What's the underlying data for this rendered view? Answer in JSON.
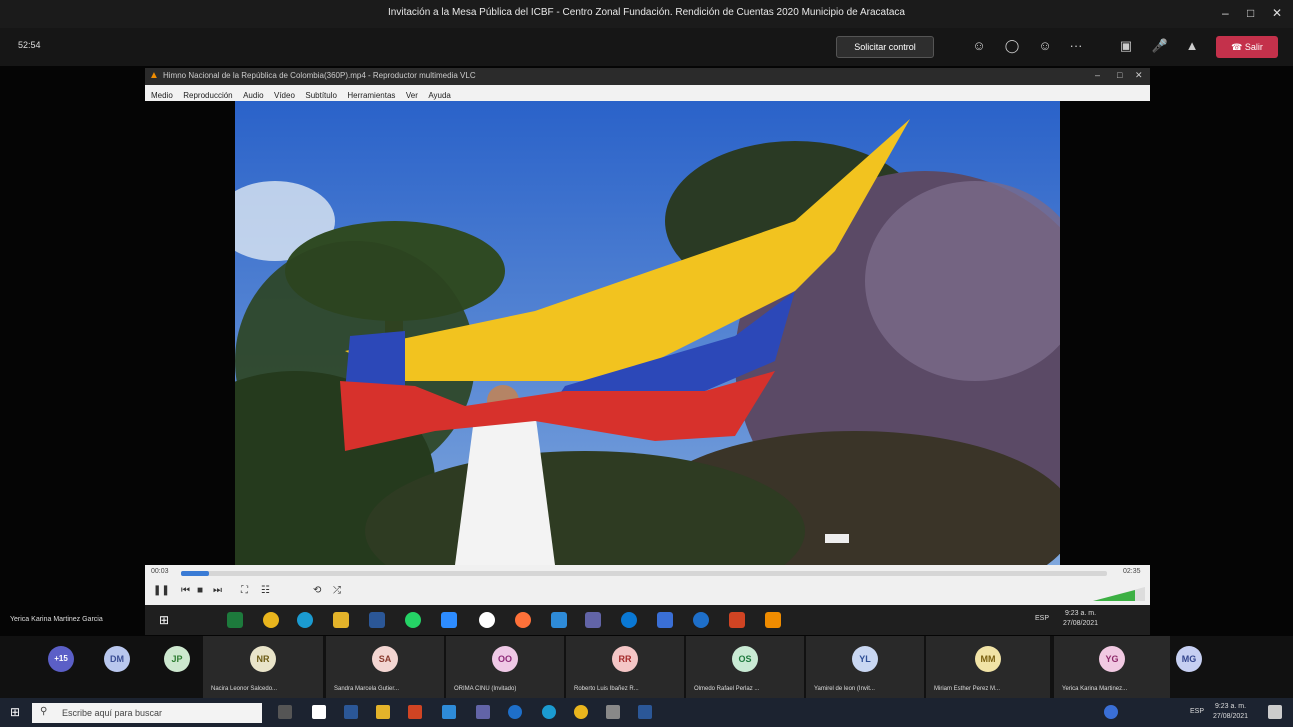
{
  "window": {
    "title": "Invitación a la Mesa Pública del ICBF - Centro Zonal Fundación. Rendición de Cuentas 2020 Municipio de Aracataca",
    "controls": [
      "–",
      "□",
      "✕"
    ]
  },
  "toolbar": {
    "timer": "52:54",
    "request_control_label": "Solicitar control",
    "more_label": "···",
    "leave_label": "Salir"
  },
  "vlc": {
    "title": "Himno Nacional de la República de Colombia(360P).mp4 - Reproductor multimedia VLC",
    "menu": [
      "Medio",
      "Reproducción",
      "Audio",
      "Vídeo",
      "Subtítulo",
      "Herramientas",
      "Ver",
      "Ayuda"
    ],
    "time_elapsed": "00:03",
    "time_total": "02:35",
    "progress": 0.03,
    "controls": [
      "❚❚",
      "⏮",
      "■",
      "⏭",
      "⛶",
      "☷",
      "⟲",
      "⤮"
    ]
  },
  "presenter": {
    "name": "Yerica Karina Martinez Garcia",
    "clock_time": "9:23 a. m.",
    "clock_date": "27/08/2021",
    "lang": "ESP"
  },
  "participants": {
    "overflow": "+15",
    "avatars": [
      {
        "initials": "DM",
        "name": "",
        "bg": "#b9c7ee",
        "fg": "#3c4f95"
      },
      {
        "initials": "JP",
        "name": "",
        "bg": "#cde8cf",
        "fg": "#2e7d32"
      },
      {
        "initials": "NR",
        "name": "Nacira Leonor Salcedo...",
        "bg": "#e9e4c9",
        "fg": "#6b5a12"
      },
      {
        "initials": "SA",
        "name": "Sandra Marcela Gutier...",
        "bg": "#f3d6d2",
        "fg": "#8a3b2e"
      },
      {
        "initials": "OO",
        "name": "ORIMA CINU (Invitado)",
        "bg": "#efc9e6",
        "fg": "#8e2a78"
      },
      {
        "initials": "RR",
        "name": "Roberto Luis Ibañez R...",
        "bg": "#f4c6c6",
        "fg": "#a42a2a"
      },
      {
        "initials": "OS",
        "name": "Olmedo Rafael Perlaz ...",
        "bg": "#c9ead4",
        "fg": "#1f7a3e"
      },
      {
        "initials": "YL",
        "name": "Yamirel de leon (Invit...",
        "bg": "#c9d7f2",
        "fg": "#2f4f96"
      },
      {
        "initials": "MM",
        "name": "Miriam Esther Perez M...",
        "bg": "#f1e3a6",
        "fg": "#7a6011"
      },
      {
        "initials": "YG",
        "name": "Yerica Karina Martinez...",
        "bg": "#f1c9e2",
        "fg": "#8e2a6a"
      },
      {
        "initials": "MG",
        "name": "",
        "bg": "#c6cff2",
        "fg": "#34468e"
      }
    ]
  },
  "host_taskbar": {
    "search_placeholder": "Escribe aquí para buscar",
    "clock_time": "9:23 a. m.",
    "clock_date": "27/08/2021",
    "lang": "ESP"
  }
}
